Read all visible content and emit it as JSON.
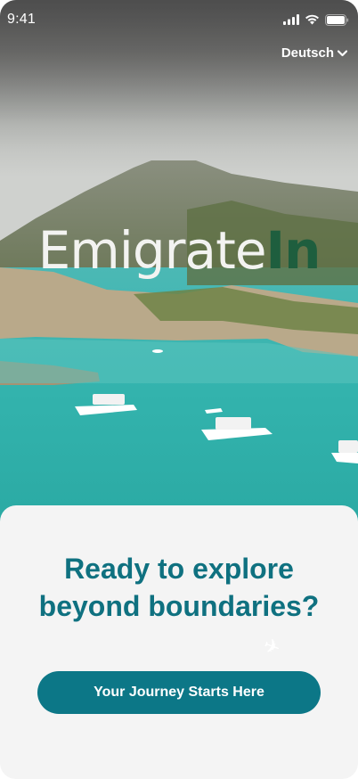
{
  "status_bar": {
    "time": "9:41"
  },
  "language_selector": {
    "label": "Deutsch",
    "icon": "chevron-down-icon"
  },
  "brand": {
    "part1": "Emigrate",
    "part2": "In"
  },
  "card": {
    "headline": "Ready to explore beyond boundaries?",
    "cta_label": "Your Journey Starts Here",
    "decor_icon": "paper-plane-icon"
  },
  "colors": {
    "primary": "#0c7787",
    "headline": "#0f7180",
    "brand_accent": "#1e5e3e",
    "card_bg": "#f4f4f4"
  }
}
